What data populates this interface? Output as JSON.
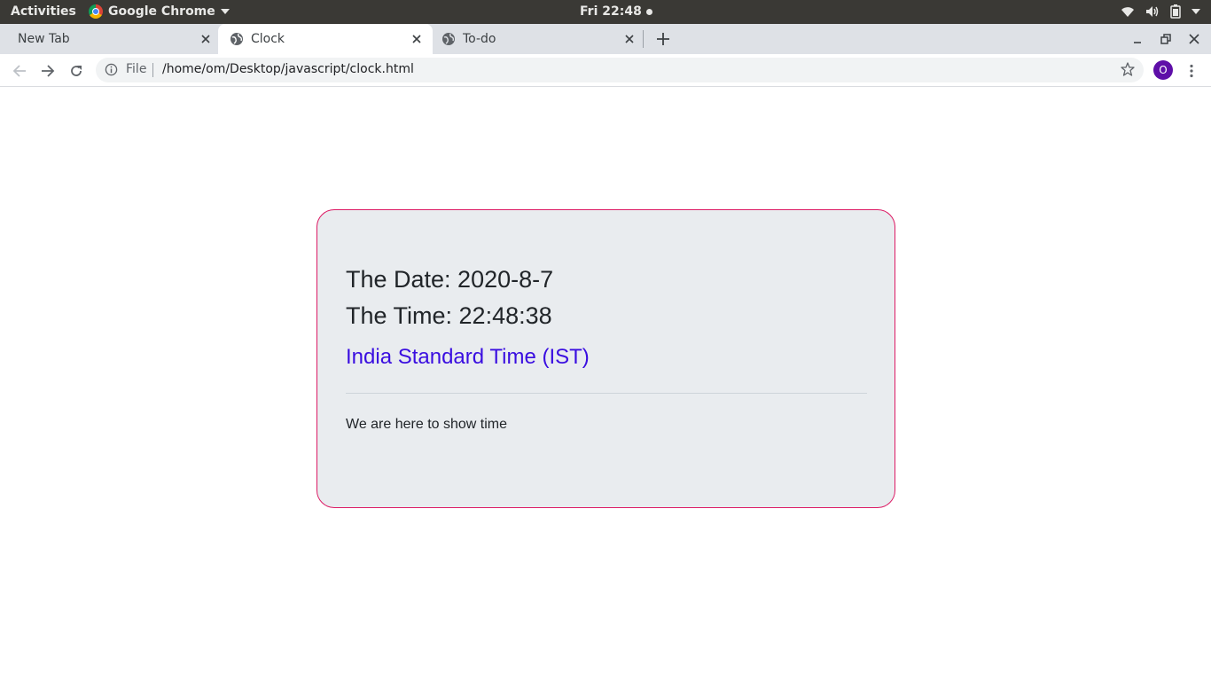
{
  "system_bar": {
    "activities": "Activities",
    "app_name": "Google Chrome",
    "clock": "Fri 22:48"
  },
  "tabs": [
    {
      "title": "New Tab",
      "active": false
    },
    {
      "title": "Clock",
      "active": true
    },
    {
      "title": "To-do",
      "active": false
    }
  ],
  "toolbar": {
    "scheme_label": "File",
    "url": "/home/om/Desktop/javascript/clock.html",
    "avatar_initial": "O"
  },
  "page": {
    "date_line": "The Date: 2020-8-7",
    "time_line": "The Time: 22:48:38",
    "timezone": "India Standard Time (IST)",
    "description": "We are here to show time"
  },
  "colors": {
    "card_border": "#dc1a64",
    "card_background": "#e9ecef",
    "timezone_text": "#3a0ee0",
    "avatar": "#5e0ea8"
  },
  "icons": {
    "back": "arrow-left-icon",
    "forward": "arrow-right-icon",
    "reload": "reload-icon",
    "info": "info-icon",
    "bookmark": "star-icon",
    "menu": "kebab-menu-icon",
    "tab_favicon": "globe-icon"
  }
}
